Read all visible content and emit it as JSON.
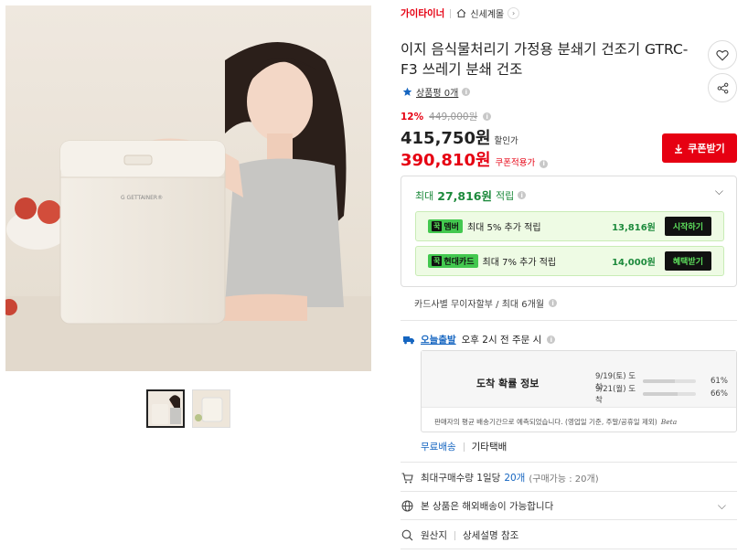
{
  "breadcrumb": {
    "brand": "가이타이너",
    "store": "신세계몰"
  },
  "product": {
    "title": "이지 음식물처리기 가정용 분쇄기 건조기 GTRC-F3 쓰레기 분쇄 건조",
    "reviews": "상품평 0개",
    "device_logo": "G GETTAINER®"
  },
  "price": {
    "discount_rate": "12%",
    "original": "449,000원",
    "sale_price": "415,750원",
    "sale_label": "할인가",
    "coupon_price": "390,810원",
    "coupon_label": "쿠폰적용가",
    "coupon_button": "쿠폰받기"
  },
  "rewards": {
    "headline_prefix": "최대",
    "headline_amount": "27,816원",
    "headline_suffix": "적립",
    "items": [
      {
        "tag": "멤버",
        "text": "최대 5% 추가 적립",
        "amount": "13,816원",
        "button": "시작하기"
      },
      {
        "tag": "현대카드",
        "text": "최대 7% 추가 적립",
        "amount": "14,000원",
        "button": "혜택받기"
      }
    ],
    "installment": "카드사별 무이자할부 / 최대 6개월"
  },
  "delivery": {
    "badge": "오늘출발",
    "cutoff": "오후 2시 전 주문 시",
    "arrival_title": "도착 확률 정보",
    "arrival_rows": [
      {
        "date": "9/19(토) 도착",
        "pct": "61%",
        "fill": 0.61
      },
      {
        "date": "9/21(월) 도착",
        "pct": "66%",
        "fill": 0.66
      }
    ],
    "note": "판매자의 평균 배송기간으로 예측되었습니다. (영업일 기준, 주말/공휴일 제외)",
    "beta": "Beta",
    "free_shipping": "무료배송",
    "carrier": "기타택배"
  },
  "purchase_limit": {
    "label": "최대구매수량 1일당",
    "value": "20개",
    "sub": "(구매가능 : 20개)"
  },
  "overseas": {
    "label": "본 상품은 해외배송이 가능합니다"
  },
  "origin": {
    "label": "원산지",
    "value": "상세설명 참조"
  },
  "colors": {
    "accent_red": "#e60012",
    "reward_green": "#1d8a3c",
    "link_blue": "#1565c0"
  }
}
